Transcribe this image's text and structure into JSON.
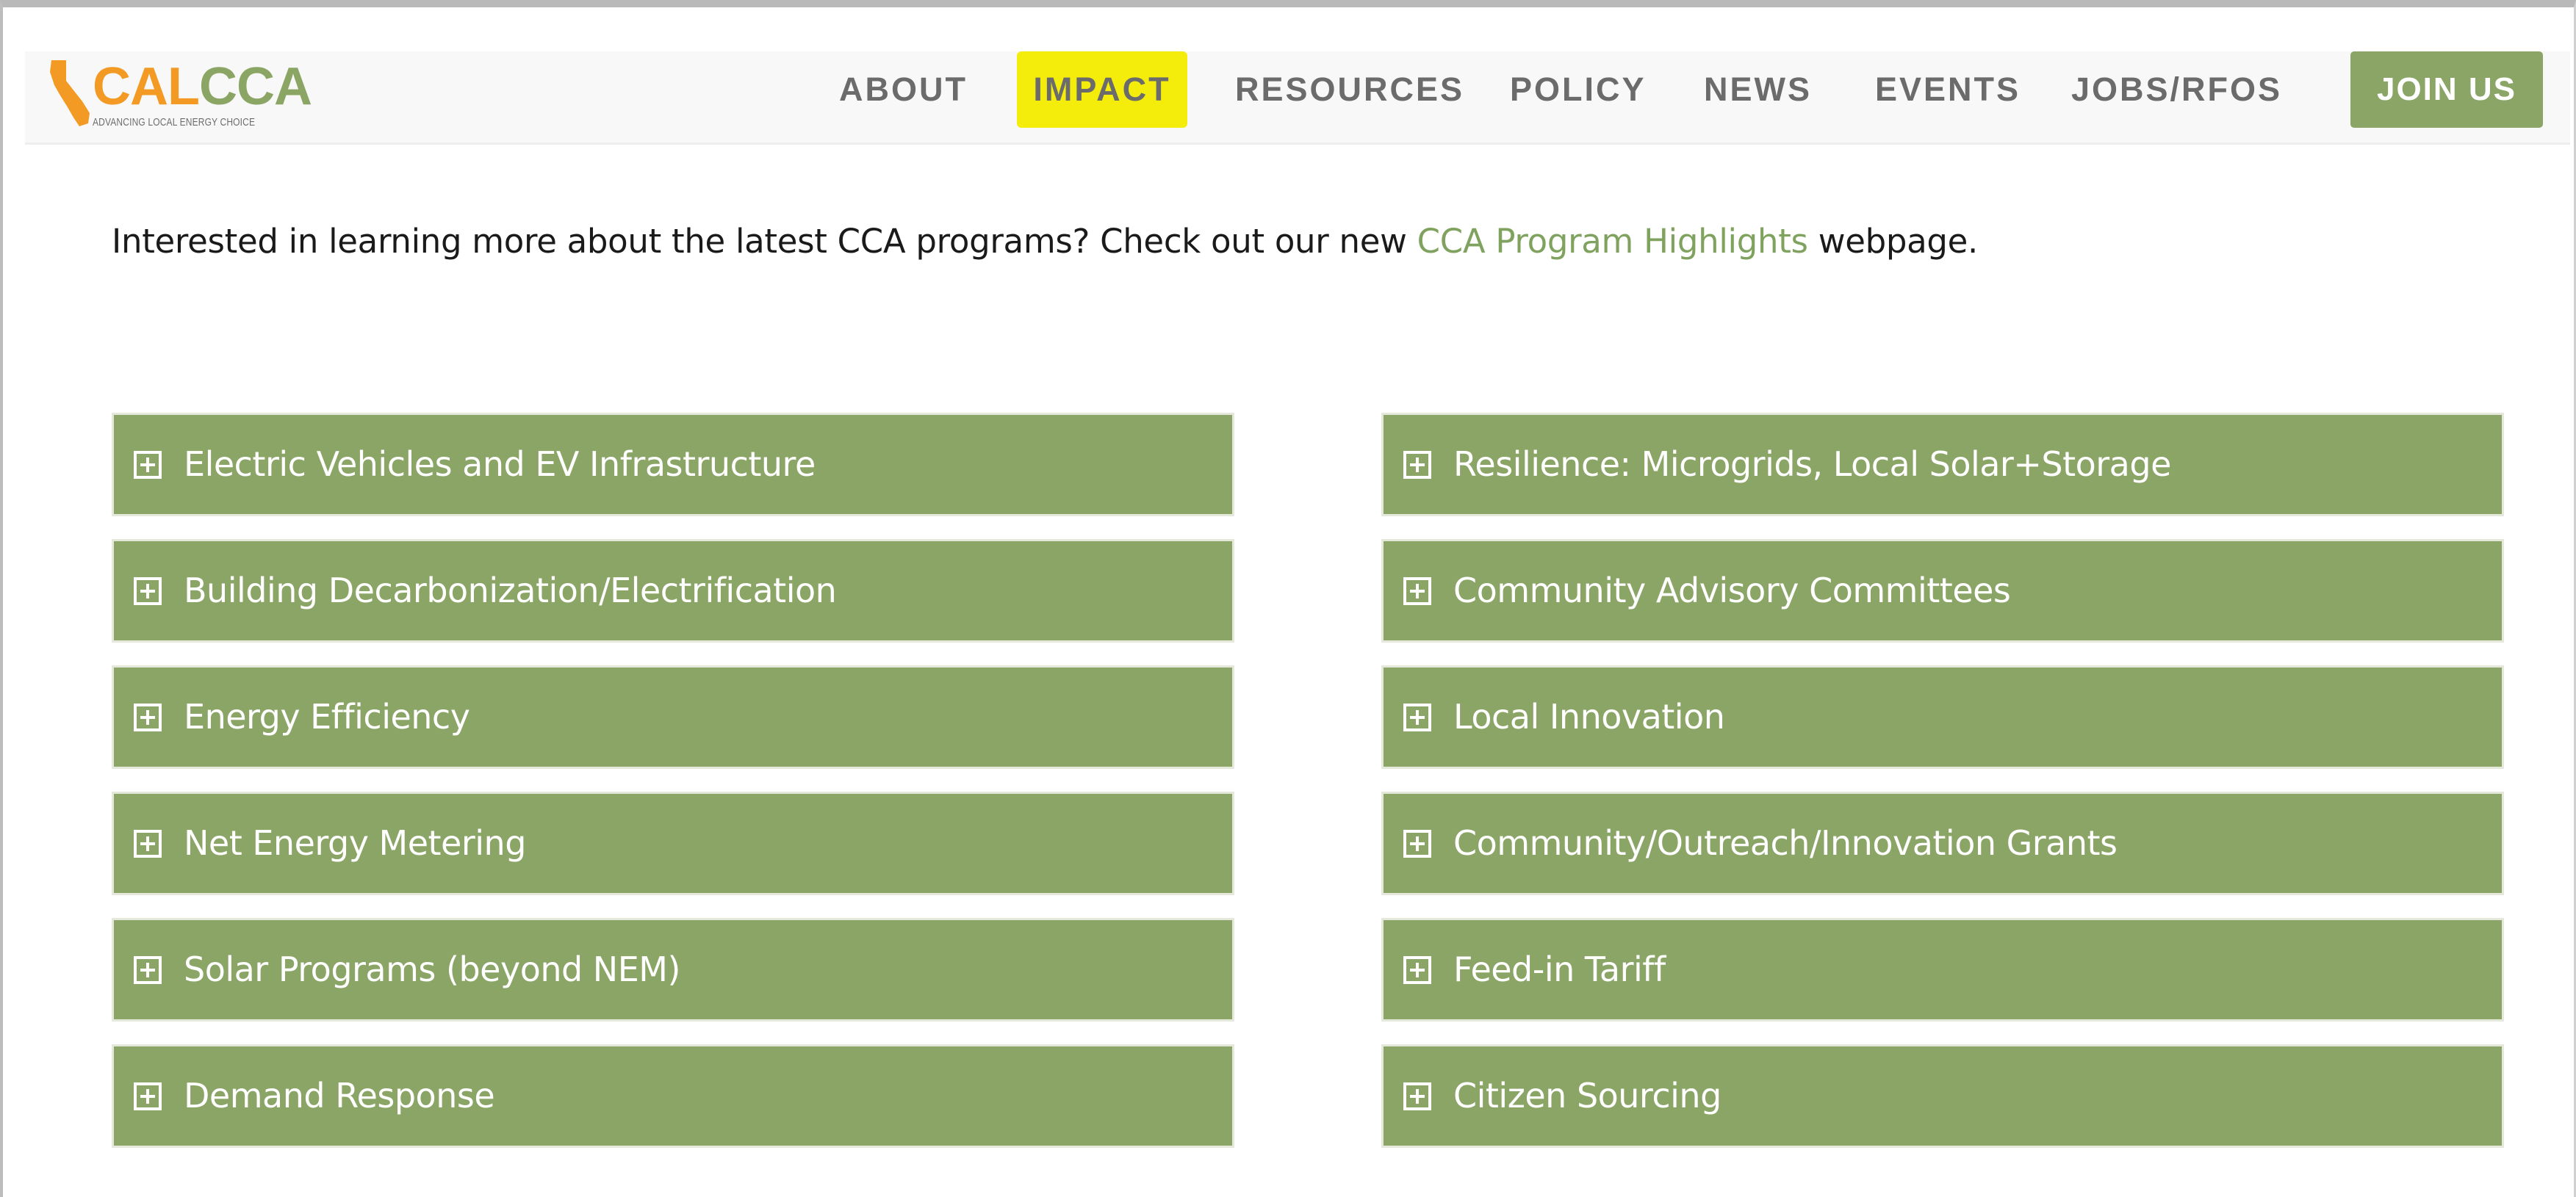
{
  "logo": {
    "brand_cal": "CAL",
    "brand_cca": "CCA",
    "tagline": "ADVANCING LOCAL ENERGY CHOICE",
    "colors": {
      "cal": "#f29a24",
      "cca": "#8aa564"
    }
  },
  "nav": {
    "items": [
      {
        "label": "ABOUT",
        "active": false
      },
      {
        "label": "IMPACT",
        "active": true
      },
      {
        "label": "RESOURCES",
        "active": false
      },
      {
        "label": "POLICY",
        "active": false
      },
      {
        "label": "NEWS",
        "active": false
      },
      {
        "label": "EVENTS",
        "active": false
      },
      {
        "label": "JOBS/RFOS",
        "active": false
      }
    ],
    "join_label": "JOIN US",
    "highlight_color": "#f4ec0b"
  },
  "intro": {
    "text_before": "Interested in learning more about the latest CCA programs? Check out our new ",
    "link_text": "CCA Program Highlights",
    "text_after": " webpage."
  },
  "accordion": {
    "left": [
      {
        "label": "Electric Vehicles and EV Infrastructure",
        "icon": "plus-square-icon"
      },
      {
        "label": "Building Decarbonization/Electrification",
        "icon": "plus-square-icon"
      },
      {
        "label": "Energy Efficiency",
        "icon": "plus-square-icon"
      },
      {
        "label": "Net Energy Metering",
        "icon": "plus-square-icon"
      },
      {
        "label": "Solar Programs (beyond NEM)",
        "icon": "plus-square-icon"
      },
      {
        "label": "Demand Response",
        "icon": "plus-square-icon"
      }
    ],
    "right": [
      {
        "label": "Resilience: Microgrids, Local Solar+Storage",
        "icon": "plus-square-icon"
      },
      {
        "label": "Community Advisory Committees",
        "icon": "plus-square-icon"
      },
      {
        "label": "Local Innovation",
        "icon": "plus-square-icon"
      },
      {
        "label": "Community/Outreach/Innovation Grants",
        "icon": "plus-square-icon"
      },
      {
        "label": "Feed-in Tariff",
        "icon": "plus-square-icon"
      },
      {
        "label": "Citizen Sourcing",
        "icon": "plus-square-icon"
      }
    ],
    "panel_color": "#8ba566"
  }
}
